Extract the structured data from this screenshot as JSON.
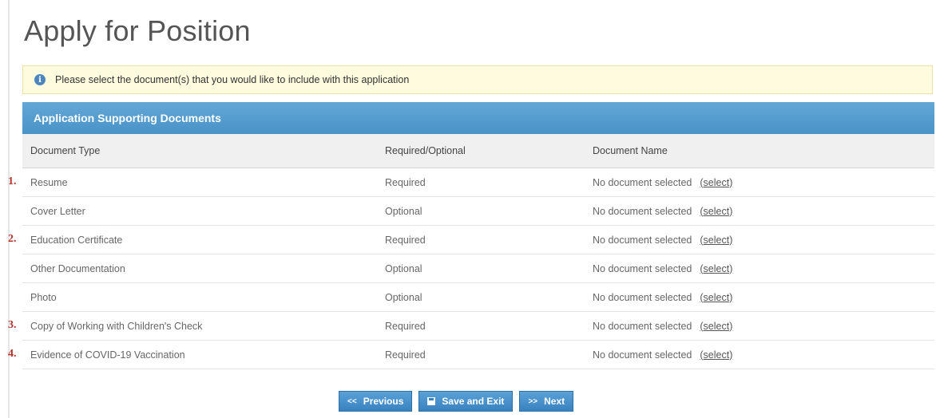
{
  "page": {
    "title": "Apply for Position"
  },
  "info": {
    "icon": "info-icon",
    "message": "Please select the document(s) that you would like to include with this application"
  },
  "section": {
    "title": "Application Supporting Documents"
  },
  "table": {
    "headers": [
      "Document Type",
      "Required/Optional",
      "Document Name"
    ],
    "rows": [
      {
        "number": "1.",
        "type": "Resume",
        "requirement": "Required",
        "doc_name": "No document selected",
        "action": "(select)"
      },
      {
        "number": "",
        "type": "Cover Letter",
        "requirement": "Optional",
        "doc_name": "No document selected",
        "action": "(select)"
      },
      {
        "number": "2.",
        "type": "Education Certificate",
        "requirement": "Required",
        "doc_name": "No document selected",
        "action": "(select)"
      },
      {
        "number": "",
        "type": "Other Documentation",
        "requirement": "Optional",
        "doc_name": "No document selected",
        "action": "(select)"
      },
      {
        "number": "",
        "type": "Photo",
        "requirement": "Optional",
        "doc_name": "No document selected",
        "action": "(select)"
      },
      {
        "number": "3.",
        "type": "Copy of Working with Children's Check",
        "requirement": "Required",
        "doc_name": "No document selected",
        "action": "(select)"
      },
      {
        "number": "4.",
        "type": "Evidence of COVID-19 Vaccination",
        "requirement": "Required",
        "doc_name": "No document selected",
        "action": "(select)"
      }
    ]
  },
  "buttons": {
    "previous": {
      "label": "Previous",
      "icon_glyph": "<<"
    },
    "save": {
      "label": "Save and Exit",
      "icon": "save-icon"
    },
    "next": {
      "label": "Next",
      "icon_glyph": ">>"
    }
  },
  "colors": {
    "header_blue": "#4993c8",
    "info_background": "#fefbdf",
    "annotation_red": "#b2342c"
  }
}
